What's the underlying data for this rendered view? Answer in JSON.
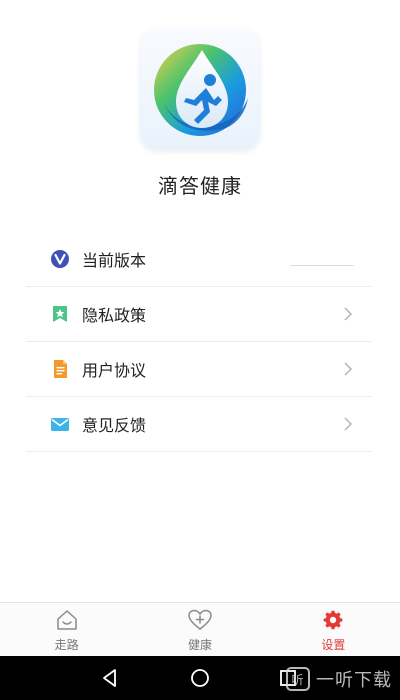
{
  "app": {
    "title": "滴答健康",
    "icon": "running-drop-icon"
  },
  "menu": [
    {
      "label": "当前版本",
      "icon": "v-badge-icon",
      "has_chevron": false,
      "value": ""
    },
    {
      "label": "隐私政策",
      "icon": "bookmark-star-icon",
      "has_chevron": true
    },
    {
      "label": "用户协议",
      "icon": "document-icon",
      "has_chevron": true
    },
    {
      "label": "意见反馈",
      "icon": "envelope-icon",
      "has_chevron": true
    }
  ],
  "tabs": [
    {
      "label": "走路",
      "icon": "smile-house-icon",
      "active": false
    },
    {
      "label": "健康",
      "icon": "heart-plus-icon",
      "active": false
    },
    {
      "label": "设置",
      "icon": "gear-icon",
      "active": true
    }
  ],
  "colors": {
    "active_tab": "#e53935",
    "inactive_tab": "#777777",
    "divider": "#ececec"
  },
  "watermark": {
    "text": "一听下载",
    "logo_glyph": "听"
  }
}
